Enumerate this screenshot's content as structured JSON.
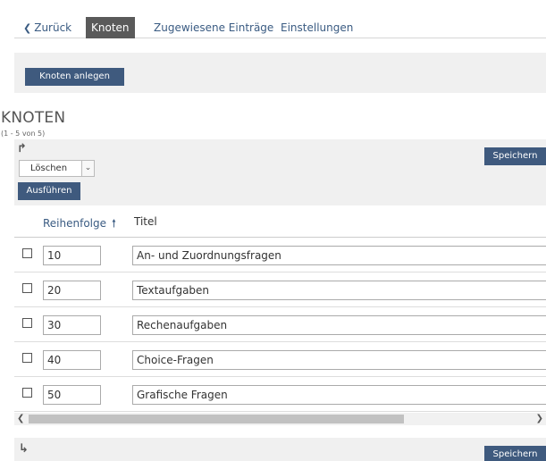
{
  "tabs": {
    "back": "Zurück",
    "nodes": "Knoten",
    "assigned": "Zugewiesene Einträge",
    "settings": "Einstellungen"
  },
  "toolbar": {
    "create_label": "Knoten anlegen"
  },
  "section": {
    "title": "KNOTEN",
    "count": "(1 - 5 von 5)"
  },
  "actions": {
    "select_value": "Löschen",
    "run_label": "Ausführen",
    "save_label": "Speichern"
  },
  "table": {
    "headers": {
      "order": "Reihenfolge",
      "title": "Titel"
    },
    "rows": [
      {
        "order": "10",
        "title": "An- und Zuordnungsfragen"
      },
      {
        "order": "20",
        "title": "Textaufgaben"
      },
      {
        "order": "30",
        "title": "Rechenaufgaben"
      },
      {
        "order": "40",
        "title": "Choice-Fragen"
      },
      {
        "order": "50",
        "title": "Grafische Fragen"
      }
    ]
  },
  "icons": {
    "back": "chevron-left-icon",
    "sort": "arrow-up-icon",
    "actions_top": "turn-right-arrow-icon",
    "actions_bottom": "turn-down-right-arrow-icon"
  },
  "colors": {
    "accent": "#3f5a7e",
    "link": "#3a5b82",
    "active_tab": "#5a5a5a",
    "toolbar_bg": "#f0f0f0"
  }
}
